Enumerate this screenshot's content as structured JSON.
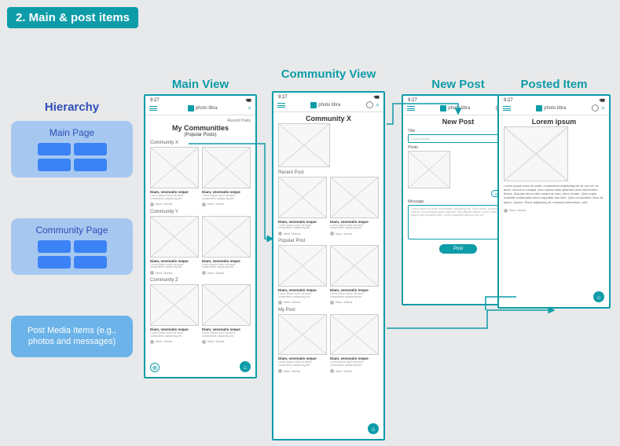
{
  "badge": "2. Main & post items",
  "hierarchy": {
    "title": "Hierarchy",
    "main": "Main Page",
    "community": "Community Page",
    "post": "Post Media Items (e.g., photos and messages)"
  },
  "columns": {
    "c1": "Main View",
    "c2": "Community View",
    "c3": "New Post",
    "c4": "Posted Item"
  },
  "status_time": "9:27",
  "logo_text": "photo libra",
  "main_view": {
    "recent_link": "Recent Posts",
    "title": "My Communities",
    "subtitle": "(Popular Posts)",
    "sections": [
      "Community X",
      "Community Y",
      "Community Z"
    ],
    "card_title": "Diam, venenatis neque",
    "card_body": "Lorem ipsum dolor sit amet, consectetur adipiscing elit.",
    "card_user": "Nunc. Viverra"
  },
  "community_view": {
    "title": "Community X",
    "sections": [
      "Recent Post",
      "Popular Post",
      "My Post"
    ],
    "card_title": "Diam, venenatis neque",
    "card_body": "Lorem ipsum dolor sit amet, consectetur adipiscing elit.",
    "card_user": "Nunc. Viverra"
  },
  "new_post": {
    "title": "New Post",
    "title_label": "Title",
    "title_placeholder": "Lorem ipsum",
    "photo_label": "Photo",
    "upload": "upload",
    "msg_label": "Message",
    "msg_placeholder": "Lorem ipsum sit amet, consectetur adipiscing elit. Tortor purus, pharetra vitae nibh at, mi accumsan quam. Aliquam.\n\nAliq ultricies sapien, quam. Nasc lacinia eget hendrerit duis. Lorem suspendi ultricies nec sed ",
    "post_button": "Post"
  },
  "posted": {
    "title": "Lorem ipsum",
    "body": "Lorem ipsum dolor sit amet, consectetur adipiscing elit sit orci sit, mi amet, cursus a volutpat. Arcu omare vitae pharetra urna elementum fectus. Aliquam lacus odio ornare at urna, tortor ornare. Quis turpis molestie malesuada tortor vulputate arci nibh. Quis consectetur risus sit ipsum, lipsum. Risus adipiscing et, euismod fermentum, sed.",
    "user": "Nunc. Viverra"
  }
}
